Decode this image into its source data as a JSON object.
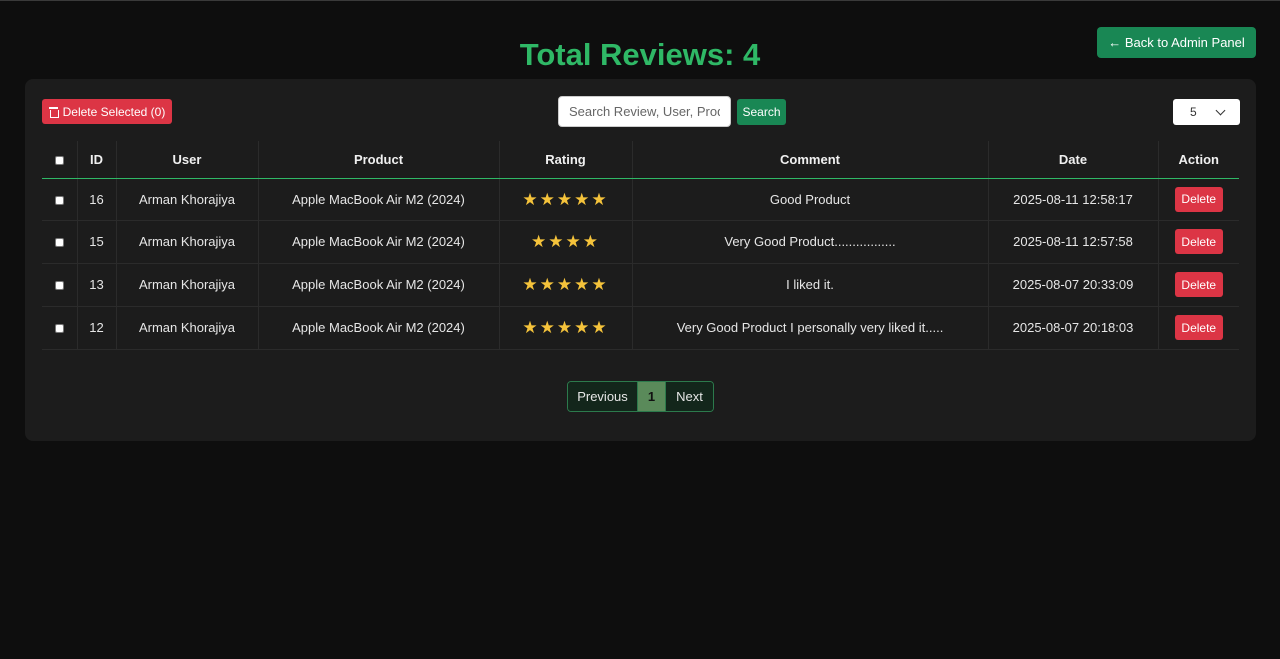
{
  "header": {
    "title": "Total Reviews: 4",
    "back_label": "← Back to Admin Panel"
  },
  "toolbar": {
    "delete_selected_label": "Delete Selected (0)",
    "search_placeholder": "Search Review, User, Product",
    "search_label": "Search",
    "per_page_value": "5"
  },
  "table": {
    "columns": [
      "ID",
      "User",
      "Product",
      "Rating",
      "Comment",
      "Date",
      "Action"
    ],
    "rows": [
      {
        "id": "16",
        "user": "Arman Khorajiya",
        "product": "Apple MacBook Air M2 (2024)",
        "rating": 5,
        "stars": "★★★★★",
        "comment": "Good Product",
        "date": "2025-08-11 12:58:17",
        "action": "Delete"
      },
      {
        "id": "15",
        "user": "Arman Khorajiya",
        "product": "Apple MacBook Air M2 (2024)",
        "rating": 4,
        "stars": "★★★★",
        "comment": "Very Good Product.................",
        "date": "2025-08-11 12:57:58",
        "action": "Delete"
      },
      {
        "id": "13",
        "user": "Arman Khorajiya",
        "product": "Apple MacBook Air M2 (2024)",
        "rating": 5,
        "stars": "★★★★★",
        "comment": "I liked it.",
        "date": "2025-08-07 20:33:09",
        "action": "Delete"
      },
      {
        "id": "12",
        "user": "Arman Khorajiya",
        "product": "Apple MacBook Air M2 (2024)",
        "rating": 5,
        "stars": "★★★★★",
        "comment": "Very Good Product I personally very liked it.....",
        "date": "2025-08-07 20:18:03",
        "action": "Delete"
      }
    ]
  },
  "pagination": {
    "previous_label": "Previous",
    "current_page": "1",
    "next_label": "Next"
  },
  "colors": {
    "accent_green": "#198754",
    "title_green": "#2fb866",
    "danger_red": "#dc3545",
    "star_yellow": "#f5c33b"
  },
  "icons": {
    "back": "arrow-left-icon",
    "delete_selected": "trash-icon",
    "per_page": "chevron-down-icon",
    "rating": "star-icon"
  }
}
